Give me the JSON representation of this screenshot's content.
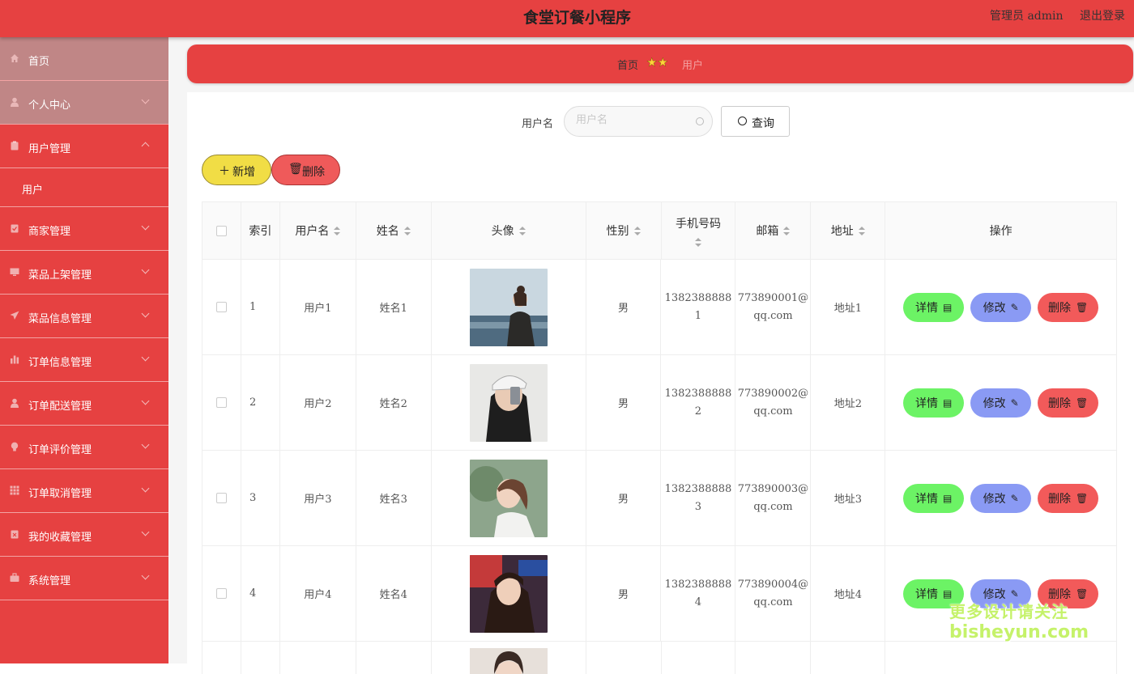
{
  "header": {
    "title": "食堂订餐小程序",
    "admin": "管理员 admin",
    "logout": "退出登录"
  },
  "sidebar": {
    "items": [
      {
        "label": "首页",
        "icon": "home-icon"
      },
      {
        "label": "个人中心",
        "icon": "user-icon"
      },
      {
        "label": "用户管理",
        "icon": "clipboard-icon"
      },
      {
        "label": "商家管理",
        "icon": "clipboard-check-icon"
      },
      {
        "label": "菜品上架管理",
        "icon": "monitor-icon"
      },
      {
        "label": "菜品信息管理",
        "icon": "send-icon"
      },
      {
        "label": "订单信息管理",
        "icon": "bar-chart-icon"
      },
      {
        "label": "订单配送管理",
        "icon": "user-icon"
      },
      {
        "label": "订单评价管理",
        "icon": "bulb-icon"
      },
      {
        "label": "订单取消管理",
        "icon": "grid-icon"
      },
      {
        "label": "我的收藏管理",
        "icon": "clipboard-x-icon"
      },
      {
        "label": "系统管理",
        "icon": "briefcase-icon"
      }
    ],
    "sub_item": "用户"
  },
  "breadcrumb": {
    "home": "首页",
    "current": "用户"
  },
  "search": {
    "label": "用户名",
    "placeholder": "用户名",
    "button": "查询"
  },
  "toolbar": {
    "add": "新增",
    "delete": "删除"
  },
  "table": {
    "headers": [
      "索引",
      "用户名",
      "姓名",
      "头像",
      "性别",
      "手机号码",
      "邮箱",
      "地址",
      "操作"
    ],
    "rows": [
      {
        "index": "1",
        "username": "用户1",
        "name": "姓名1",
        "gender": "男",
        "phone": "1382388888 1",
        "email": "773890001@ qq.com",
        "address": "地址1"
      },
      {
        "index": "2",
        "username": "用户2",
        "name": "姓名2",
        "gender": "男",
        "phone": "1382388888 2",
        "email": "773890002@ qq.com",
        "address": "地址2"
      },
      {
        "index": "3",
        "username": "用户3",
        "name": "姓名3",
        "gender": "男",
        "phone": "1382388888 3",
        "email": "773890003@ qq.com",
        "address": "地址3"
      },
      {
        "index": "4",
        "username": "用户4",
        "name": "姓名4",
        "gender": "男",
        "phone": "1382388888 4",
        "email": "773890004@ qq.com",
        "address": "地址4"
      }
    ],
    "actions": {
      "detail": "详情",
      "edit": "修改",
      "delete": "删除"
    }
  },
  "watermark": {
    "line1": "更多设计请关注",
    "line2": "bisheyun.com"
  },
  "colors": {
    "primary": "#e64141",
    "detail": "#6cf365",
    "edit": "#8a9af4",
    "delete": "#f25a5a",
    "add": "#f1dd45"
  }
}
